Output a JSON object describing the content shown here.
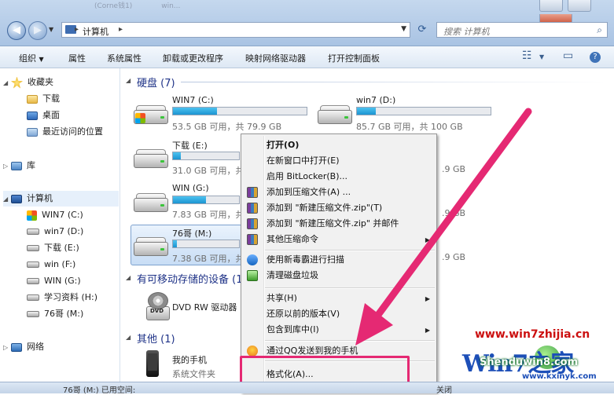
{
  "window": {
    "address": "计算机",
    "search_placeholder": "搜索 计算机",
    "faded_tabs": [
      "(Corne钱1)",
      "",
      "",
      "win...",
      ""
    ]
  },
  "toolbar": {
    "organize": "组织",
    "properties": "属性",
    "system_properties": "系统属性",
    "uninstall": "卸载或更改程序",
    "map_drive": "映射网络驱动器",
    "control_panel": "打开控制面板"
  },
  "sidebar": {
    "favorites": "收藏夹",
    "downloads": "下载",
    "desktop": "桌面",
    "recent": "最近访问的位置",
    "libraries": "库",
    "computer": "计算机",
    "drives": [
      "WIN7 (C:)",
      "win7 (D:)",
      "下载 (E:)",
      "win (F:)",
      "WIN (G:)",
      "学习资料 (H:)",
      "76哥 (M:)"
    ],
    "network": "网络"
  },
  "content": {
    "hdd_header": "硬盘 (7)",
    "drives": [
      {
        "name": "WIN7 (C:)",
        "free": "53.5 GB 可用，共 79.9 GB",
        "used": 0.33
      },
      {
        "name": "win7 (D:)",
        "free": "85.7 GB 可用，共 100 GB",
        "used": 0.14
      },
      {
        "name": "下载 (E:)",
        "free": "31.0 GB 可用，共 1",
        "used": 0.12
      },
      {
        "name": "WIN (G:)",
        "free": "7.83 GB 可用，共 1",
        "used": 0.5
      },
      {
        "name": "76哥 (M:)",
        "free": "7.38 GB 可用，共 1",
        "used": 0.06
      }
    ],
    "right_partial": [
      ".9 GB",
      ".9 GB",
      ".9 GB"
    ],
    "removable_header": "有可移动存储的设备 (1)",
    "dvd_name": "DVD RW 驱动器",
    "other_header": "其他 (1)",
    "phone_name": "我的手机",
    "phone_type": "系统文件夹"
  },
  "context_menu": {
    "items": [
      {
        "label": "打开(O)",
        "bold": true
      },
      {
        "label": "在新窗口中打开(E)"
      },
      {
        "label": "启用 BitLocker(B)..."
      },
      {
        "label": "添加到压缩文件(A) ..."
      },
      {
        "label": "添加到 \"新建压缩文件.zip\"(T)"
      },
      {
        "label": "添加到 \"新建压缩文件.zip\" 并邮件"
      },
      {
        "label": "其他压缩命令"
      },
      {
        "label": "使用新毒霸进行扫描"
      },
      {
        "label": "清理磁盘垃圾"
      },
      {
        "label": "共享(H)"
      },
      {
        "label": "还原以前的版本(V)"
      },
      {
        "label": "包含到库中(I)"
      },
      {
        "label": "通过QQ发送到我的手机"
      },
      {
        "label": "格式化(A)..."
      }
    ]
  },
  "status": {
    "left": "76哥 (M:)  已用空间:",
    "right": "关闭"
  },
  "watermark": {
    "url": "www.win7zhijia.cn",
    "logo_big": "Win7之家",
    "logo_sub": "Shenduwin8.com",
    "site": "www.kxinyk.com"
  },
  "colors": {
    "highlight": "#e52973",
    "accent": "#1e3287",
    "bar": "#1c94d1"
  }
}
